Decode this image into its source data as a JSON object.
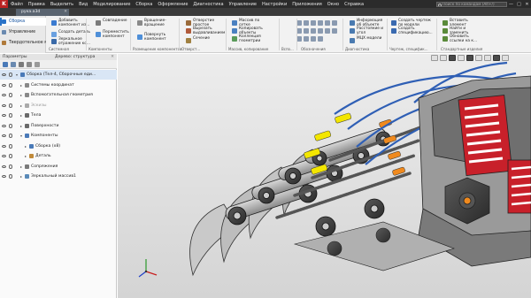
{
  "app": {
    "logo": "K",
    "menu": [
      "Файл",
      "Правка",
      "Выделить",
      "Вид",
      "Моделирование",
      "Сборка",
      "Оформление",
      "Диагностика",
      "Управление",
      "Настройки",
      "Приложения",
      "Окно",
      "Справка"
    ],
    "search_placeholder": "Поиск по командам (Alt+/)",
    "window_buttons": [
      "—",
      "□",
      "✕"
    ]
  },
  "document_tab": {
    "label": "рука.a3d",
    "close": "✕"
  },
  "ribbon": {
    "tabs": [
      {
        "label": "Сборка",
        "active": true,
        "icon_color": "#2a73c8"
      },
      {
        "label": "Управление",
        "active": false,
        "icon_color": "#6a8ab0"
      },
      {
        "label": "Твердотельное моделирование",
        "active": false,
        "icon_color": "#b07a3a"
      }
    ],
    "commands": [
      {
        "label": "Добавить\nкомпонент из...",
        "icon_color": "#3b7bd0"
      },
      {
        "label": "Создать деталь",
        "icon_color": "#6aa0e0"
      },
      {
        "label": "Зеркальное\nотражение ко...",
        "icon_color": "#3a6aa8"
      },
      {
        "label": "Совпадение",
        "icon_color": "#7a7a7a"
      },
      {
        "label": "Вращение-\nвращение",
        "icon_color": "#8a8a8a"
      },
      {
        "label": "Переместить\nкомпонент",
        "icon_color": "#4f8fd8"
      },
      {
        "label": "Повернуть\nкомпонент",
        "icon_color": "#4f8fd8"
      },
      {
        "label": "Отверстие\nпростое",
        "icon_color": "#9a6a3a"
      },
      {
        "label": "Вырезать\nвыдавливанием",
        "icon_color": "#b05a3a"
      },
      {
        "label": "Сечение",
        "icon_color": "#a08040"
      },
      {
        "label": "Массив по\nсетке",
        "icon_color": "#4a80c0"
      },
      {
        "label": "Копировать\nобъекты",
        "icon_color": "#4a80c0"
      },
      {
        "label": "Коллекция\nгеометрии",
        "icon_color": "#5a9a5a"
      },
      {
        "label": "Информация\nоб объекте",
        "icon_color": "#4a7ab0"
      },
      {
        "label": "Расстояние и\nугол",
        "icon_color": "#4a7ab0"
      },
      {
        "label": "МЦХ модели",
        "icon_color": "#4a7ab0"
      },
      {
        "label": "Создать чертеж\nпо модели",
        "icon_color": "#3a6ab0"
      },
      {
        "label": "Создать\nспецификацию...",
        "icon_color": "#3a6ab0"
      },
      {
        "label": "Вставить\nэлемент",
        "icon_color": "#5a8a3a"
      },
      {
        "label": "Найти и\nзаменить",
        "icon_color": "#5a8a3a"
      },
      {
        "label": "Обновить\nссылки на к...",
        "icon_color": "#5a8a3a"
      }
    ],
    "groups": [
      "Системная",
      "Компоненты",
      "Размещение компонентов",
      "Отверст...",
      "Массив, копирование",
      "Вспо...",
      "Обозначения",
      "Диагностика",
      "Чертеж, специфик...",
      "Стандартные изделия"
    ]
  },
  "panel": {
    "title": "Параметры",
    "tab_right": "Дерево: структура",
    "pin": "✕",
    "tree": [
      {
        "label": "Сборка (Тел-4, Сборочные еди...",
        "level": 0,
        "expanded": true,
        "selected": true,
        "dim": false,
        "icon_color": "#4a7ab8"
      },
      {
        "label": "Системы координат",
        "level": 1,
        "expanded": false,
        "selected": false,
        "dim": false,
        "icon_color": "#888888"
      },
      {
        "label": "Вспомогательная геометрия",
        "level": 1,
        "expanded": false,
        "selected": false,
        "dim": false,
        "icon_color": "#888888"
      },
      {
        "label": "Эскизы",
        "level": 1,
        "expanded": false,
        "selected": false,
        "dim": true,
        "icon_color": "#aaaaaa"
      },
      {
        "label": "Тела",
        "level": 1,
        "expanded": false,
        "selected": false,
        "dim": false,
        "icon_color": "#6a6a6a"
      },
      {
        "label": "Поверхности",
        "level": 1,
        "expanded": false,
        "selected": false,
        "dim": false,
        "icon_color": "#6a6a6a"
      },
      {
        "label": "Компоненты",
        "level": 1,
        "expanded": true,
        "selected": false,
        "dim": false,
        "icon_color": "#4a7ab8"
      },
      {
        "label": "Сборка (x8)",
        "level": 2,
        "expanded": false,
        "selected": false,
        "dim": false,
        "icon_color": "#4a7ab8"
      },
      {
        "label": "Деталь",
        "level": 2,
        "expanded": false,
        "selected": false,
        "dim": false,
        "icon_color": "#c08a3a"
      },
      {
        "label": "Сопряжения",
        "level": 1,
        "expanded": false,
        "selected": false,
        "dim": false,
        "icon_color": "#7a7a7a"
      },
      {
        "label": "Зеркальный массив1",
        "level": 1,
        "expanded": false,
        "selected": false,
        "dim": false,
        "icon_color": "#5a8ab8"
      }
    ]
  },
  "colors": {
    "accent": "#2a73c8",
    "link_yellow": "#f3e600",
    "link_orange": "#f08a1e",
    "cable_blue": "#2f5fb5",
    "housing_red": "#c8202a"
  }
}
